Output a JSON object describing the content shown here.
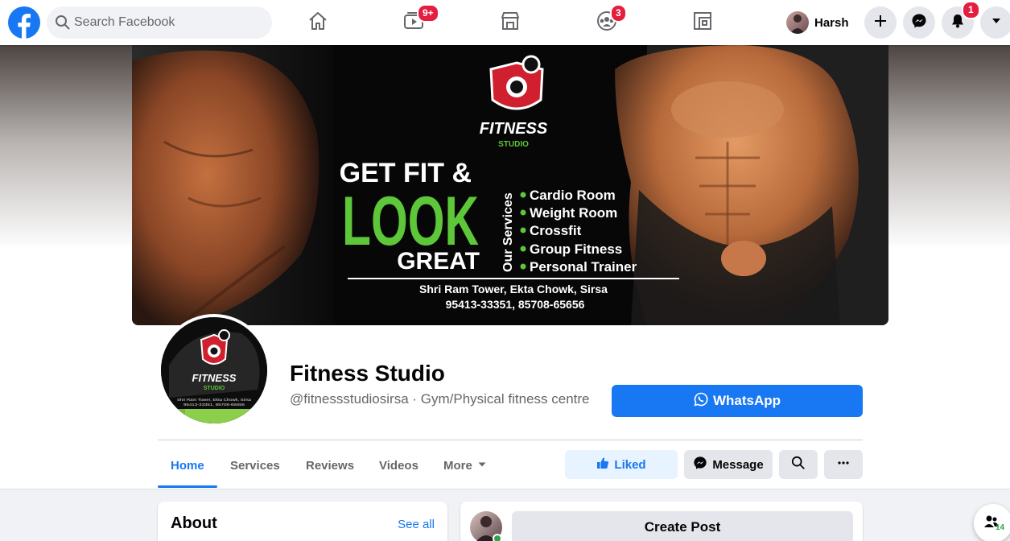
{
  "topbar": {
    "search_placeholder": "Search Facebook",
    "watch_badge": "9+",
    "groups_badge": "3",
    "user_name": "Harsh",
    "notifications_badge": "1",
    "nav_icons": [
      "home-icon",
      "watch-icon",
      "marketplace-icon",
      "groups-icon",
      "gaming-icon"
    ],
    "brand_color": "#1877f2",
    "badge_color": "#e41e3f"
  },
  "cover": {
    "brand_name": "FITNESS",
    "brand_sub": "STUDIO",
    "headline_1": "GET FIT &",
    "headline_2": "LOOK",
    "headline_3": "GREAT",
    "services_label": "Our Services",
    "services": [
      "Cardio Room",
      "Weight Room",
      "Crossfit",
      "Group Fitness",
      "Personal Trainer"
    ],
    "address": "Shri Ram Tower, Ekta Chowk, Sirsa",
    "phones": "95413-33351, 85708-65656",
    "accent_green": "#5dc639"
  },
  "avatar": {
    "brand_name": "FITNESS",
    "brand_sub": "STUDIO",
    "address_line": "Shri Ram Tower, Ekta Chowk, Sirsa",
    "phone_line": "95413-33351, 85708-65656"
  },
  "page": {
    "name": "Fitness Studio",
    "subtitle": "@fitnessstudiosirsa · Gym/Physical fitness centre",
    "whatsapp_label": "WhatsApp"
  },
  "tabs": [
    {
      "label": "Home"
    },
    {
      "label": "Services"
    },
    {
      "label": "Reviews"
    },
    {
      "label": "Videos"
    },
    {
      "label": "More"
    }
  ],
  "actions": {
    "liked_label": "Liked",
    "message_label": "Message"
  },
  "about": {
    "title": "About",
    "see_all": "See all"
  },
  "composer": {
    "create_post_label": "Create Post"
  },
  "contacts": {
    "count": "14"
  }
}
